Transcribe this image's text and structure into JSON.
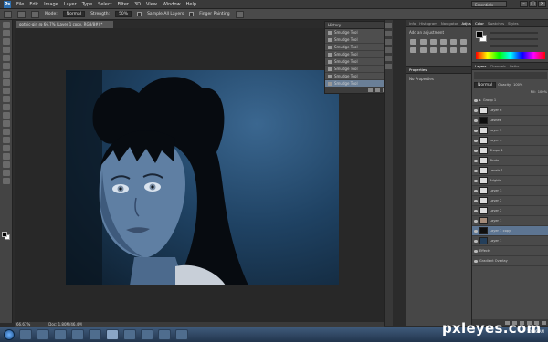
{
  "app": {
    "logo": "Ps",
    "workspace": "Essentials"
  },
  "menu": [
    "File",
    "Edit",
    "Image",
    "Layer",
    "Type",
    "Select",
    "Filter",
    "3D",
    "View",
    "Window",
    "Help"
  ],
  "options": {
    "mode_label": "Mode:",
    "mode_value": "Normal",
    "strength_label": "Strength:",
    "strength_value": "50%",
    "sample_all": "Sample All Layers",
    "finger": "Finger Painting"
  },
  "document": {
    "tab_title": "gothic-girl @ 66.7% (Layer 1 copy, RGB/8#) *",
    "zoom": "66.67%",
    "doc_size": "Doc: 1.80M/46.4M"
  },
  "history": {
    "title": "History",
    "rows": [
      "Smudge Tool",
      "Smudge Tool",
      "Smudge Tool",
      "Smudge Tool",
      "Smudge Tool",
      "Smudge Tool",
      "Smudge Tool",
      "Smudge Tool"
    ],
    "selected_index": 7
  },
  "mid_tabs": [
    "Info",
    "Histogram",
    "Navigator",
    "Adjustments"
  ],
  "adjustments": {
    "title": "Add an adjustment"
  },
  "properties": {
    "tab": "Properties",
    "text": "No Properties"
  },
  "right_tabs": [
    "Color",
    "Swatches",
    "Styles"
  ],
  "layers_tabs": [
    "Layers",
    "Channels",
    "Paths"
  ],
  "layers": {
    "blend": "Normal",
    "opacity_label": "Opacity:",
    "opacity": "100%",
    "fill_label": "Fill:",
    "fill": "100%",
    "rows": [
      {
        "name": "Group 1",
        "thumb": "folder"
      },
      {
        "name": "Layer 6",
        "thumb": "light"
      },
      {
        "name": "Lashes",
        "thumb": "dark"
      },
      {
        "name": "Layer 5",
        "thumb": "light"
      },
      {
        "name": "Layer 4",
        "thumb": "light"
      },
      {
        "name": "Shape 1",
        "thumb": "light"
      },
      {
        "name": "Photo...",
        "thumb": "light"
      },
      {
        "name": "Levels 1",
        "thumb": "light"
      },
      {
        "name": "Brightn...",
        "thumb": "light"
      },
      {
        "name": "Layer 3",
        "thumb": "light"
      },
      {
        "name": "Layer 2",
        "thumb": "light"
      },
      {
        "name": "Layer 2",
        "thumb": "light"
      },
      {
        "name": "Layer 1",
        "thumb": "face"
      },
      {
        "name": "Layer 1 copy",
        "thumb": "dark"
      },
      {
        "name": "Layer 1",
        "thumb": "blue"
      },
      {
        "name": "Effects",
        "thumb": "none"
      },
      {
        "name": "Gradient Overlay",
        "thumb": "none"
      }
    ],
    "selected_index": 13
  },
  "taskbar": {
    "clock": "10:06 AM"
  },
  "watermark": "pxleyes.com",
  "colors": {
    "canvas_mid": "#1f4263",
    "panel": "#474747",
    "selection": "#5d7592"
  }
}
